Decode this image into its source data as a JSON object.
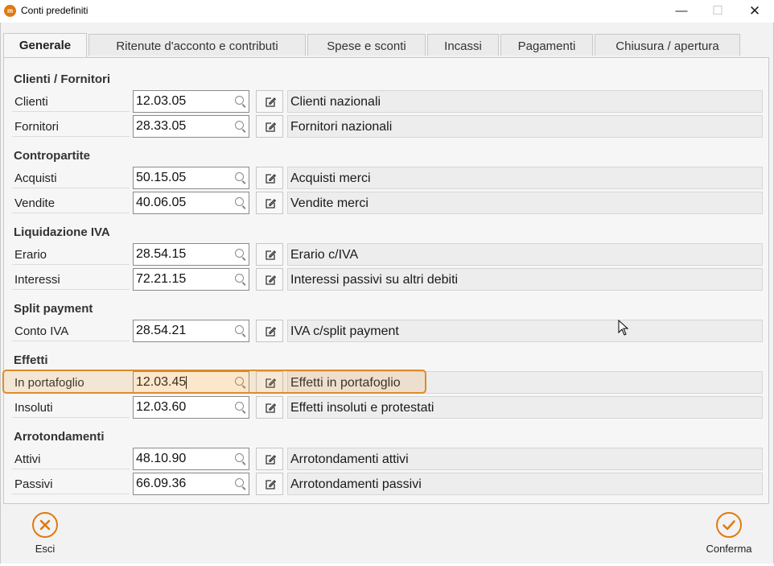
{
  "window": {
    "title": "Conti predefiniti",
    "app_icon": "m",
    "controls": {
      "minimize": "—",
      "maximize": "☐",
      "close": "✕"
    }
  },
  "tabs": [
    {
      "label": "Generale",
      "active": true
    },
    {
      "label": "Ritenute d'acconto e contributi",
      "active": false
    },
    {
      "label": "Spese e sconti",
      "active": false
    },
    {
      "label": "Incassi",
      "active": false
    },
    {
      "label": "Pagamenti",
      "active": false
    },
    {
      "label": "Chiusura / apertura",
      "active": false
    }
  ],
  "sections": [
    {
      "title": "Clienti / Fornitori",
      "rows": [
        {
          "label": "Clienti",
          "code": "12.03.05",
          "description": "Clienti nazionali"
        },
        {
          "label": "Fornitori",
          "code": "28.33.05",
          "description": "Fornitori nazionali"
        }
      ]
    },
    {
      "title": "Contropartite",
      "rows": [
        {
          "label": "Acquisti",
          "code": "50.15.05",
          "description": "Acquisti merci"
        },
        {
          "label": "Vendite",
          "code": "40.06.05",
          "description": "Vendite merci"
        }
      ]
    },
    {
      "title": "Liquidazione IVA",
      "rows": [
        {
          "label": "Erario",
          "code": "28.54.15",
          "description": "Erario c/IVA"
        },
        {
          "label": "Interessi",
          "code": "72.21.15",
          "description": "Interessi passivi su altri debiti"
        }
      ]
    },
    {
      "title": "Split payment",
      "rows": [
        {
          "label": "Conto IVA",
          "code": "28.54.21",
          "description": "IVA c/split payment"
        }
      ]
    },
    {
      "title": "Effetti",
      "rows": [
        {
          "label": "In portafoglio",
          "code": "12.03.45",
          "description": "Effetti in portafoglio"
        },
        {
          "label": "Insoluti",
          "code": "12.03.60",
          "description": "Effetti insoluti e protestati"
        }
      ]
    },
    {
      "title": "Arrotondamenti",
      "rows": [
        {
          "label": "Attivi",
          "code": "48.10.90",
          "description": "Arrotondamenti attivi"
        },
        {
          "label": "Passivi",
          "code": "66.09.36",
          "description": "Arrotondamenti passivi"
        }
      ]
    }
  ],
  "footer": {
    "cancel_label": "Esci",
    "confirm_label": "Conferma"
  },
  "colors": {
    "accent": "#e07a10",
    "highlight_border": "#e08a2c",
    "panel_bg": "#f6f6f6"
  }
}
